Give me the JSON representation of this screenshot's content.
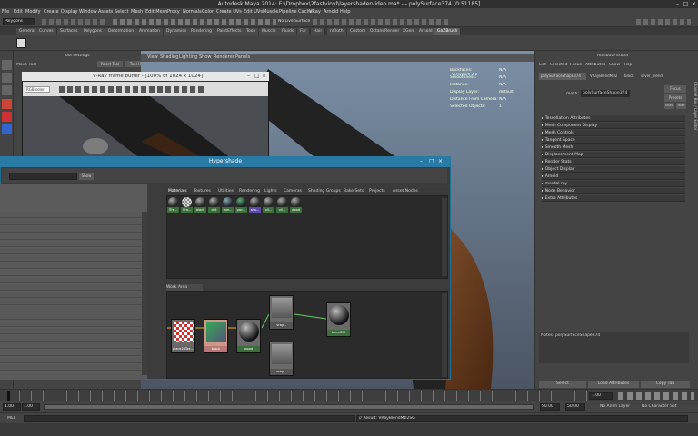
{
  "window": {
    "title": "Autodesk Maya 2014: E:\\Dropbox\\2fastvinyl\\layershadervideo.ma*   ---   polySurface374 [0:51185]"
  },
  "menubar": [
    "File",
    "Edit",
    "Modify",
    "Create",
    "Display",
    "Window",
    "Assets",
    "Select",
    "Mesh",
    "Edit Mesh",
    "Proxy",
    "Normals",
    "Color",
    "Create UVs",
    "Edit UVs",
    "Muscle",
    "Pipeline Cache",
    "VRay",
    "Arnold",
    "Help"
  ],
  "statusline": {
    "mode": "Polygons",
    "no_live": "No Live Surface"
  },
  "shelf_tabs": [
    "General",
    "Curves",
    "Surfaces",
    "Polygons",
    "Deformation",
    "Animation",
    "Dynamics",
    "Rendering",
    "PaintEffects",
    "Toon",
    "Muscle",
    "Fluids",
    "Fur",
    "Hair",
    "nCloth",
    "Custom",
    "OctaneRender",
    "XGen",
    "Arnold",
    "GoZBrush"
  ],
  "tool_settings": {
    "header": "Tool Settings",
    "tool_name": "Move Tool",
    "reset_tool": "Reset Tool",
    "tool_help": "Tool Help"
  },
  "viewport": {
    "menu": [
      "View",
      "Shading",
      "Lighting",
      "Show",
      "Renderer",
      "Panels"
    ],
    "hud_labels": [
      "Backfaces:",
      "Smoothness:",
      "Instance:",
      "Display Layer:",
      "Distance From Camera:",
      "Selected Objects:"
    ],
    "hud_values": [
      "N/A",
      "N/A",
      "N/A",
      "default",
      "N/A",
      "1"
    ],
    "name": "Viewport 2.0"
  },
  "vfb": {
    "title": "V-Ray frame buffer - [100% of 1024 x 1024]",
    "channel": "RGB color"
  },
  "hypershade": {
    "title": "Hypershade",
    "filter_btn": "Show",
    "tabs": [
      "Materials",
      "Textures",
      "Utilities",
      "Rendering",
      "Lights",
      "Cameras",
      "Shading Groups",
      "Bake Sets",
      "Projects",
      "Asset Nodes"
    ],
    "swatches": [
      "lTra...",
      "lTra...",
      "black",
      "dirt",
      "lam...",
      "pac...",
      "sha...",
      "vil...",
      "vil...",
      "wood"
    ],
    "work_area": "Work Area",
    "nodes": [
      "place2dTex...",
      "black",
      "wood",
      "vray...",
      "blendMtl",
      "vray..."
    ]
  },
  "attribute_editor": {
    "header": "Attribute Editor",
    "menu": [
      "List",
      "Selected",
      "Focus",
      "Attributes",
      "Show",
      "Help"
    ],
    "tabs": [
      "polySurfaceShape374",
      "VRayBlendMtl2",
      "black",
      "silver_blend"
    ],
    "mesh_label": "mesh:",
    "mesh_value": "polySurfaceShape374",
    "focus_btn": "Focus",
    "presets_btn": "Presets",
    "show_btn": "Show",
    "hide_btn": "Hide",
    "sections": [
      "Tessellation Attributes",
      "Mesh Component Display",
      "Mesh Controls",
      "Tangent Space",
      "Smooth Mesh",
      "Displacement Map",
      "Render Stats",
      "Object Display",
      "Arnold",
      "mental ray",
      "Node Behavior",
      "Extra Attributes"
    ],
    "notes": "Notes:  polySurfaceShape374",
    "buttons": [
      "Select",
      "Load Attributes",
      "Copy Tab"
    ],
    "side_tabs": [
      "Channel Box / Layer Editor",
      "Attribute Editor"
    ]
  },
  "timeline": {
    "ticks": [
      "1",
      "2",
      "4",
      "6",
      "8",
      "10",
      "12",
      "14",
      "16",
      "18",
      "20",
      "22",
      "24"
    ],
    "current": "1.00"
  },
  "range": {
    "start": "1.00",
    "start2": "1.00",
    "end": "50.00",
    "end2": "50.00",
    "anim_layer": "No Anim Layer",
    "char_set": "No Character Set"
  },
  "cmdline": {
    "lang": "MEL",
    "result": "// Result: VRayBlendMtl2SG"
  },
  "colors": {
    "maya_bg": "#444444",
    "hypershade_title": "#2a7aa6",
    "viewport_bg": "#6e7d8e",
    "wood": "#6b3a1c"
  }
}
